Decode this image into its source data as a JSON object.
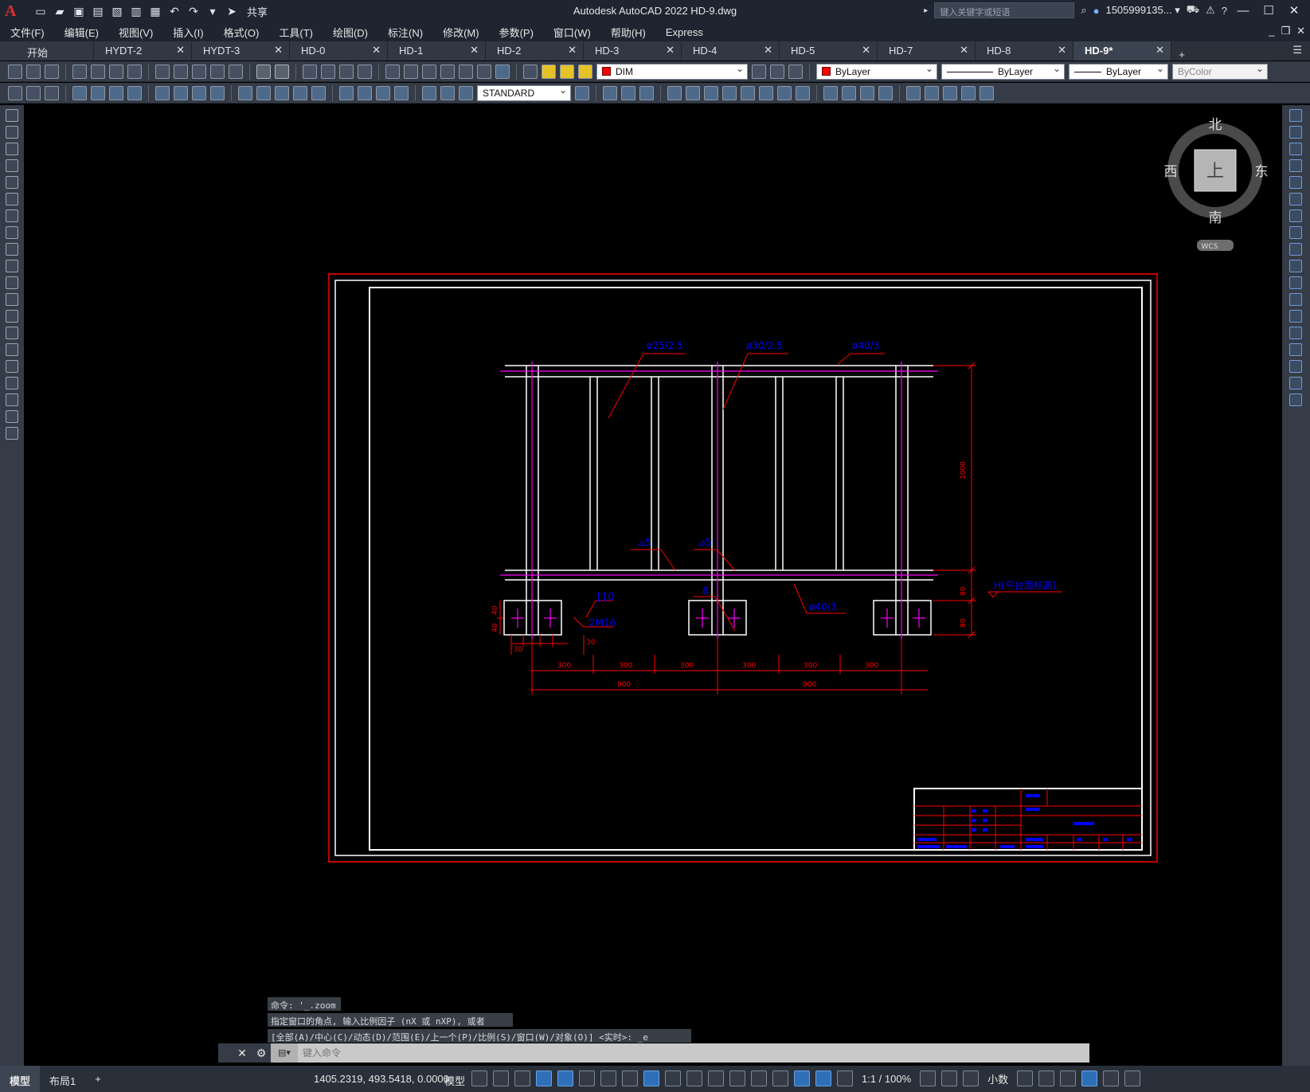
{
  "titlebar": {
    "app_title": "Autodesk AutoCAD 2022    HD-9.dwg",
    "share_label": "共享",
    "search_placeholder": "键入关键字或短语",
    "username": "1505999135... ▾",
    "logo": "A"
  },
  "menu": {
    "items": [
      "文件(F)",
      "编辑(E)",
      "视图(V)",
      "插入(I)",
      "格式(O)",
      "工具(T)",
      "绘图(D)",
      "标注(N)",
      "修改(M)",
      "参数(P)",
      "窗口(W)",
      "帮助(H)",
      "Express"
    ]
  },
  "tabs": {
    "items": [
      {
        "label": "开始"
      },
      {
        "label": "HYDT-2"
      },
      {
        "label": "HYDT-3"
      },
      {
        "label": "HD-0"
      },
      {
        "label": "HD-1"
      },
      {
        "label": "HD-2"
      },
      {
        "label": "HD-3"
      },
      {
        "label": "HD-4"
      },
      {
        "label": "HD-5"
      },
      {
        "label": "HD-7"
      },
      {
        "label": "HD-8"
      },
      {
        "label": "HD-9*"
      }
    ],
    "active": "HD-9*",
    "close_glyph": "✕",
    "add_glyph": "+"
  },
  "toolbar": {
    "layer_value": "DIM",
    "color_value": "ByLayer",
    "linetype_value": "ByLayer",
    "lineweight_value": "ByLayer",
    "plotstyle_value": "ByColor",
    "textstyle_value": "STANDARD"
  },
  "viewcube": {
    "north": "北",
    "south": "南",
    "east": "东",
    "west": "西",
    "face": "上",
    "wcs": "WCS"
  },
  "drawing": {
    "labels": {
      "pipe_top_left": "ø25/2.5",
      "pipe_top_mid": "ø30/2.5",
      "pipe_top_right": "ø40/3",
      "weld_1": "⊿5",
      "weld_2": "⊿5",
      "channel": "[10",
      "bolts": "2M16",
      "gap": "8",
      "pipe_bottom": "ø40/3",
      "elevation": "H(平台面标高)",
      "height_dim": "1000",
      "dim_80a": "80",
      "dim_80b": "80",
      "dim_40a": "40",
      "dim_40b": "40",
      "dim_30a": "30",
      "dim_30b": "30",
      "dim_300": "300",
      "dim_900": "900"
    }
  },
  "command": {
    "history": [
      "命令: '_.zoom",
      "指定窗口的角点, 输入比例因子 (nX 或 nXP), 或者",
      "[全部(A)/中心(C)/动态(D)/范围(E)/上一个(P)/比例(S)/窗口(W)/对象(O)] <实时>: _e"
    ],
    "placeholder": "键入命令"
  },
  "status": {
    "tab_model": "模型",
    "tab_layout": "布局1",
    "add": "+",
    "coords": "1405.2319, 493.5418, 0.0000",
    "model_label": "模型",
    "scale": "1:1 / 100%",
    "units": "小数"
  },
  "colors": {
    "accent_red": "#ff0000",
    "magenta": "#ff00ff",
    "dim_blue": "#0000ff",
    "frame_white": "#ffffff"
  }
}
